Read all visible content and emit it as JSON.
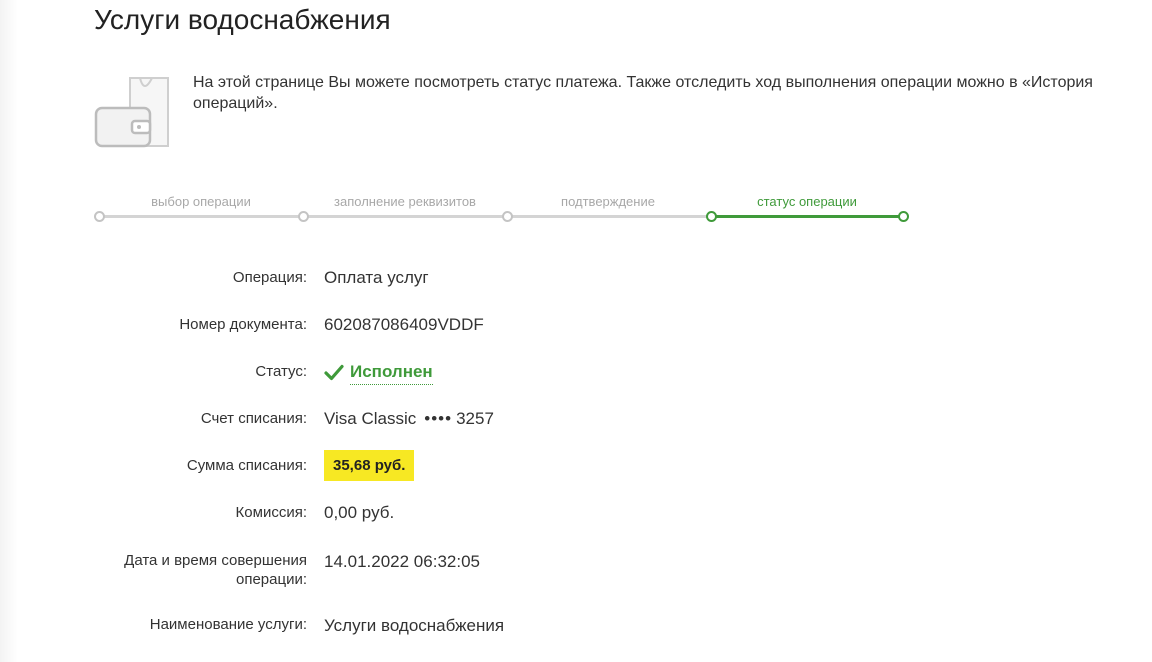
{
  "page": {
    "title": "Услуги водоснабжения"
  },
  "info": {
    "icon": "wallet-icon",
    "text": "На этой странице Вы можете посмотреть статус платежа. Также отследить ход выполнения операции можно в «История операций»."
  },
  "stepper": {
    "steps": [
      {
        "label": "выбор операции",
        "state": "done"
      },
      {
        "label": "заполнение реквизитов",
        "state": "done"
      },
      {
        "label": "подтверждение",
        "state": "done"
      },
      {
        "label": "статус операции",
        "state": "active"
      }
    ],
    "active_color": "#3f9a3a",
    "inactive_color": "#d4d4d4"
  },
  "details": {
    "operation": {
      "label": "Операция:",
      "value": "Оплата услуг"
    },
    "document_number": {
      "label": "Номер документа:",
      "value": "602087086409VDDF"
    },
    "status": {
      "label": "Статус:",
      "value": "Исполнен",
      "icon": "check-icon",
      "color": "#3f9a3a"
    },
    "account": {
      "label": "Счет списания:",
      "card_name": "Visa Classic",
      "card_mask": "••••",
      "card_last4": "3257"
    },
    "amount": {
      "label": "Сумма списания:",
      "value": "35,68 руб.",
      "highlight_color": "#f7e823"
    },
    "commission": {
      "label": "Комиссия:",
      "value": "0,00 руб."
    },
    "datetime": {
      "label": "Дата и время совершения операции:",
      "value": "14.01.2022 06:32:05"
    },
    "service_name": {
      "label": "Наименование услуги:",
      "value": "Услуги водоснабжения"
    }
  }
}
